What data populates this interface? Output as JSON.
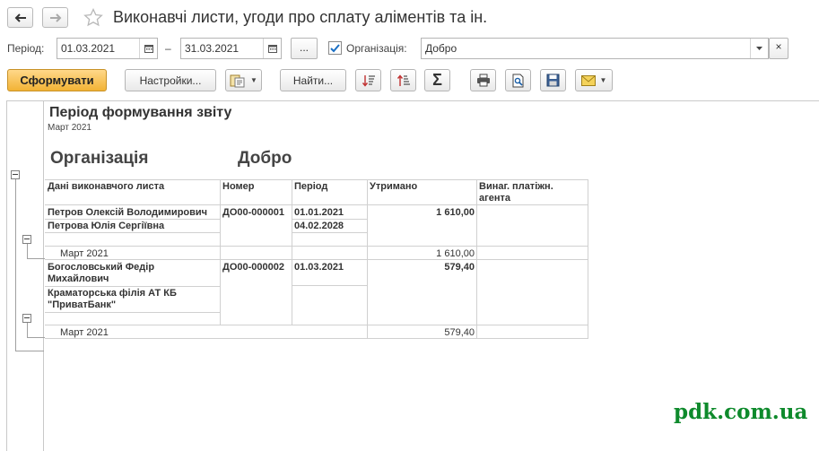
{
  "header": {
    "title": "Виконавчі листи, угоди про сплату аліментів та ін."
  },
  "filters": {
    "period_label": "Період:",
    "date_from": "01.03.2021",
    "dash": "–",
    "date_to": "31.03.2021",
    "more_label": "...",
    "org_label": "Організація:",
    "org_checked": true,
    "org_value": "Добро",
    "clear_label": "×"
  },
  "toolbar": {
    "generate_label": "Сформувати",
    "settings_label": "Настройки...",
    "find_label": "Найти...",
    "sum_label": "Σ"
  },
  "report": {
    "title": "Період формування звіту",
    "period": "Март 2021",
    "org_label": "Організація",
    "org_value": "Добро",
    "columns": [
      "Дані виконавчого листа",
      "Номер",
      "Період",
      "Утримано",
      "Винаг. платіжн.",
      "агента"
    ],
    "groups": [
      {
        "debtor": "Петров Олексій Володимирович",
        "recipient": "Петрова Юлія Сергіївна",
        "number": "ДО00-000001",
        "period_from": "01.01.2021",
        "period_to": "04.02.2028",
        "withheld": "1 610,00",
        "subtotal_label": "Март 2021",
        "subtotal_value": "1 610,00"
      },
      {
        "debtor_line1": "Богословський Федір",
        "debtor_line2": "Михайлович",
        "recipient_line1": "Краматорська філія АТ КБ",
        "recipient_line2": "\"ПриватБанк\"",
        "number": "ДО00-000002",
        "period_from": "01.03.2021",
        "withheld": "579,40",
        "subtotal_label": "Март 2021",
        "subtotal_value": "579,40"
      }
    ]
  },
  "watermark": "pdk.com.ua",
  "colors": {
    "primary": "#f2b335",
    "watermark": "#0e8a2c",
    "checkbox": "#1a6fc4"
  }
}
